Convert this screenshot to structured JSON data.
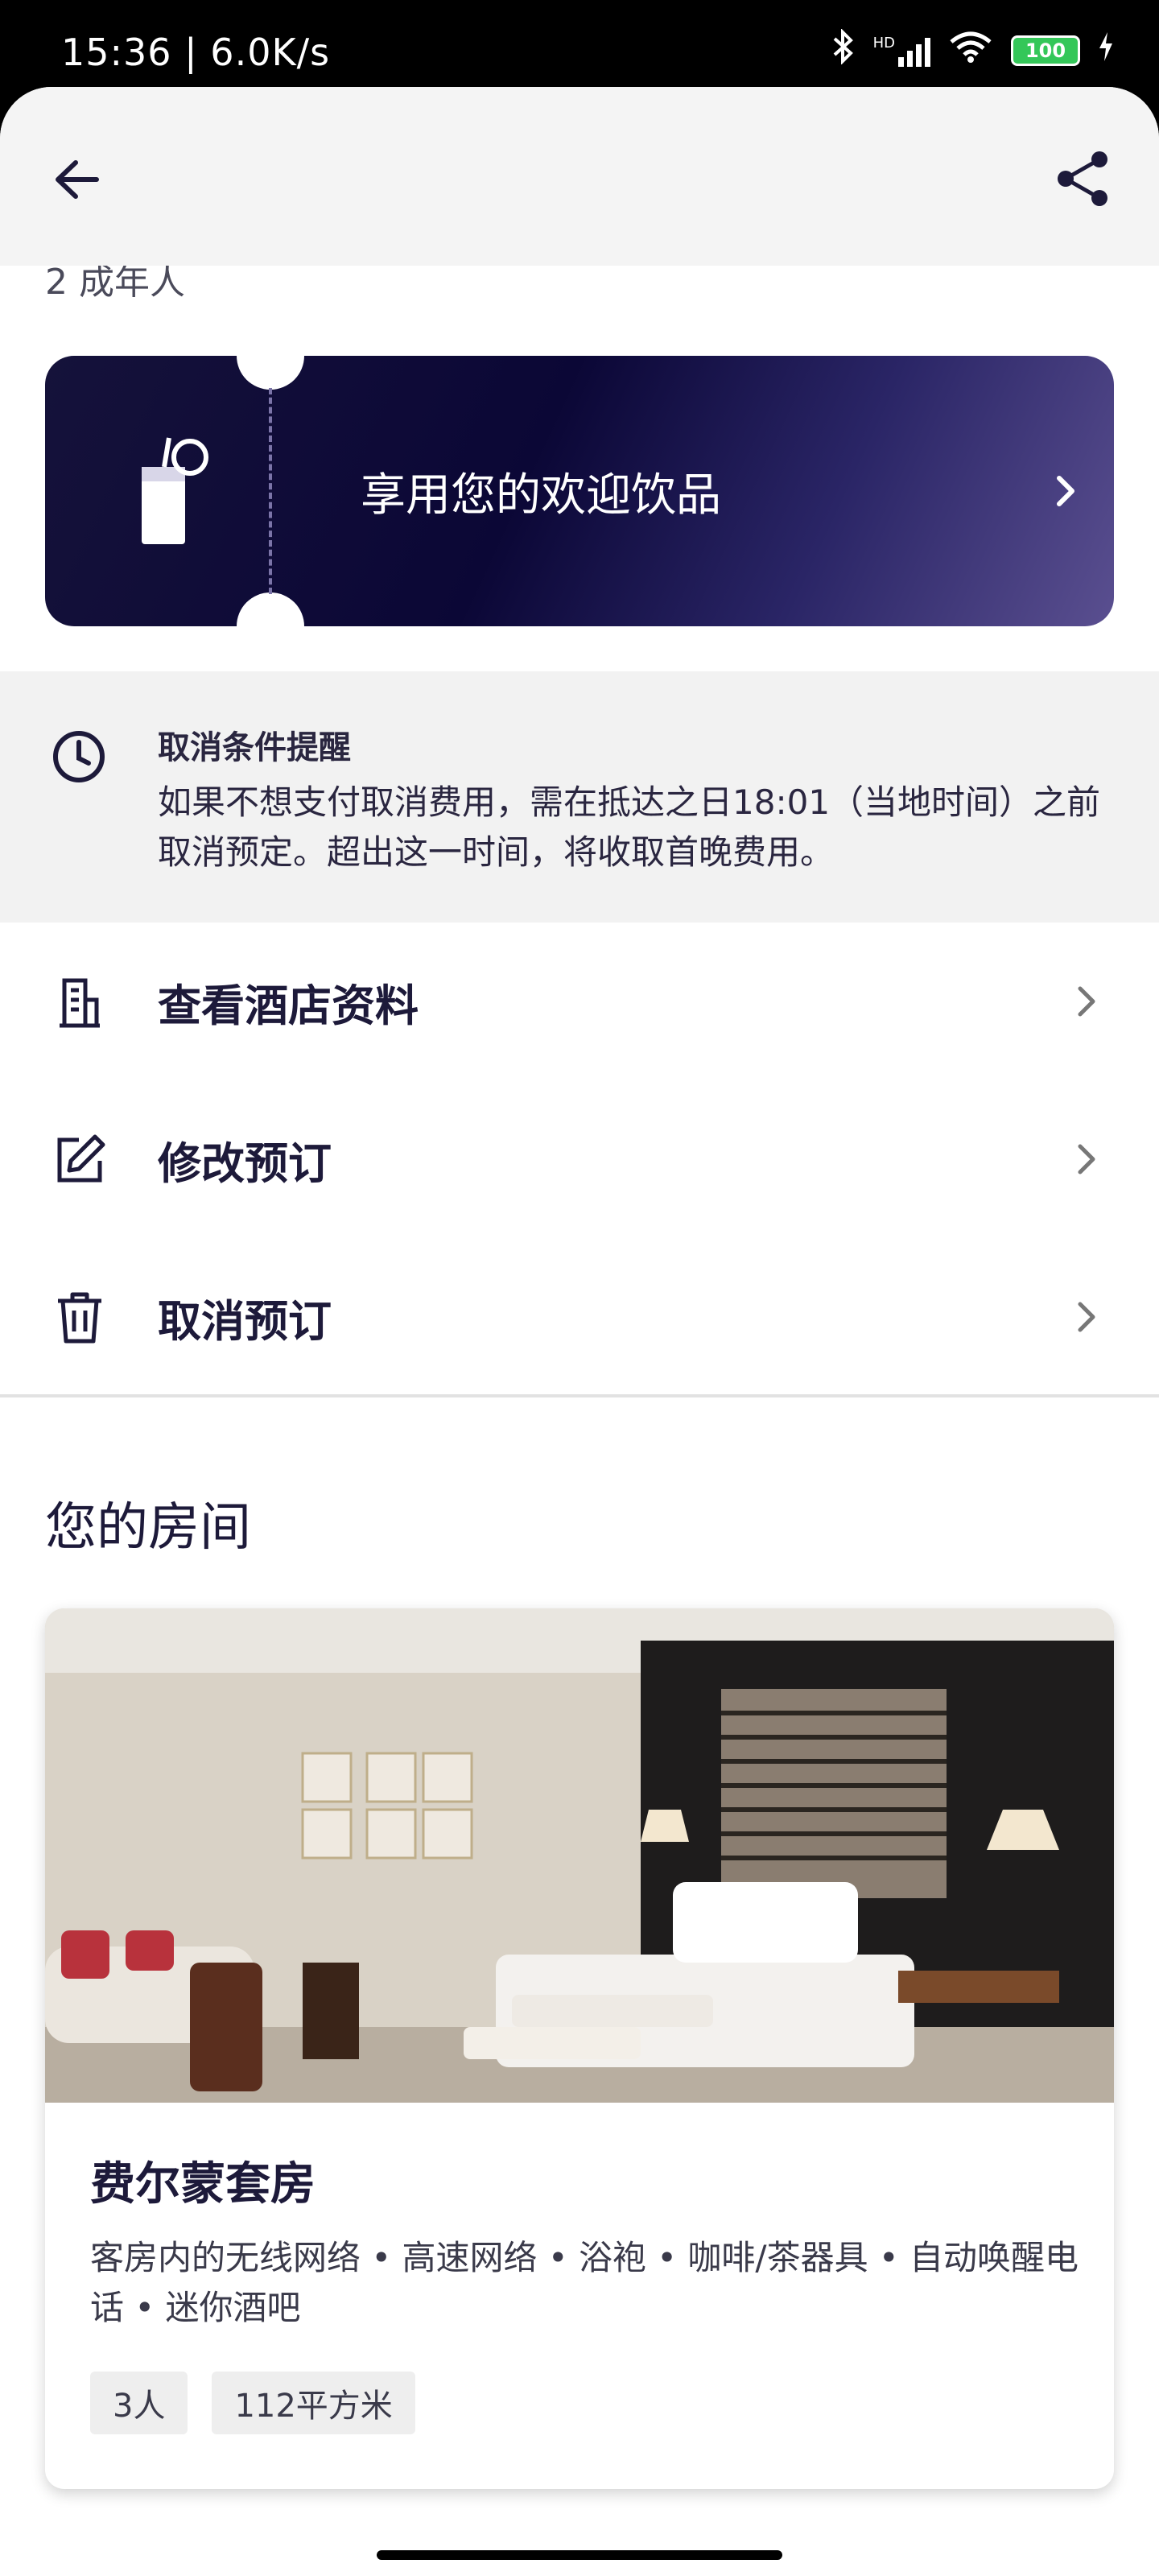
{
  "status_bar": {
    "time": "15:36 | 6.0K/s",
    "network": "HD",
    "battery": "100"
  },
  "header": {
    "partial_text": "2 成年人"
  },
  "drink": {
    "label": "享用您的欢迎饮品"
  },
  "notice": {
    "title": "取消条件提醒",
    "body": "如果不想支付取消费用，需在抵达之日18:01（当地时间）之前取消预定。超出这一时间，将收取首晚费用。"
  },
  "actions": [
    {
      "label": "查看酒店资料",
      "icon": "hotel-icon"
    },
    {
      "label": "修改预订",
      "icon": "edit-icon"
    },
    {
      "label": "取消预订",
      "icon": "trash-icon"
    }
  ],
  "rooms_section": {
    "title": "您的房间"
  },
  "room": {
    "name": "费尔蒙套房",
    "amenities": "客房内的无线网络 • 高速网络 • 浴袍 • 咖啡/茶器具 • 自动唤醒电话 • 迷你酒吧",
    "tags": [
      "3人",
      "112平方米"
    ]
  },
  "colors": {
    "brand_dark": "#0b0736",
    "brand_light": "#5a4f90",
    "text": "#1d1a3a"
  }
}
